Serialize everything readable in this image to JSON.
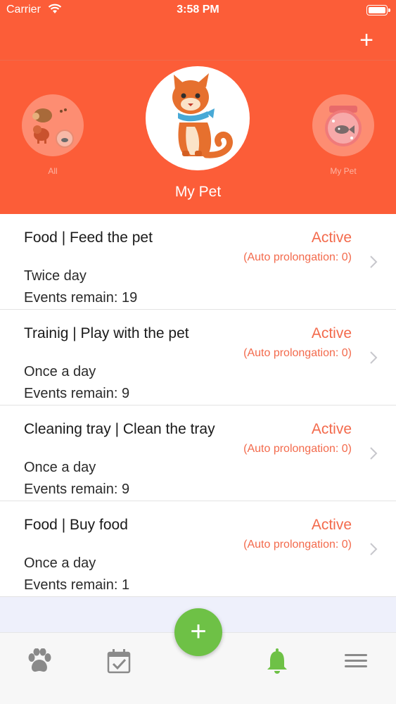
{
  "status_bar": {
    "carrier": "Carrier",
    "time": "3:58 PM"
  },
  "nav": {
    "add_label": "+"
  },
  "pets": {
    "all_label": "All",
    "selected_label": "My Pet",
    "other_label": "My Pet"
  },
  "tasks": [
    {
      "title": "Food | Feed the pet",
      "state": "Active",
      "prolongation": "(Auto prolongation: 0)",
      "frequency": "Twice day",
      "remaining": "Events remain: 19"
    },
    {
      "title": "Trainig | Play with the pet",
      "state": "Active",
      "prolongation": "(Auto prolongation: 0)",
      "frequency": "Once a day",
      "remaining": "Events remain: 9"
    },
    {
      "title": "Cleaning tray | Clean the tray",
      "state": "Active",
      "prolongation": "(Auto prolongation: 0)",
      "frequency": "Once a day",
      "remaining": "Events remain: 9"
    },
    {
      "title": "Food | Buy food",
      "state": "Active",
      "prolongation": "(Auto prolongation: 0)",
      "frequency": "Once a day",
      "remaining": "Events remain: 1"
    }
  ],
  "fab": {
    "label": "+"
  },
  "tabs": [
    {
      "icon": "paw-icon",
      "active": false
    },
    {
      "icon": "calendar-check-icon",
      "active": false
    },
    {
      "icon": "bell-icon",
      "active": true
    },
    {
      "icon": "menu-icon",
      "active": false
    }
  ],
  "colors": {
    "brand": "#fc5d38",
    "accent_text": "#f36a4c",
    "active_tab": "#6ec146",
    "inactive_tab": "#8a8a8a"
  }
}
